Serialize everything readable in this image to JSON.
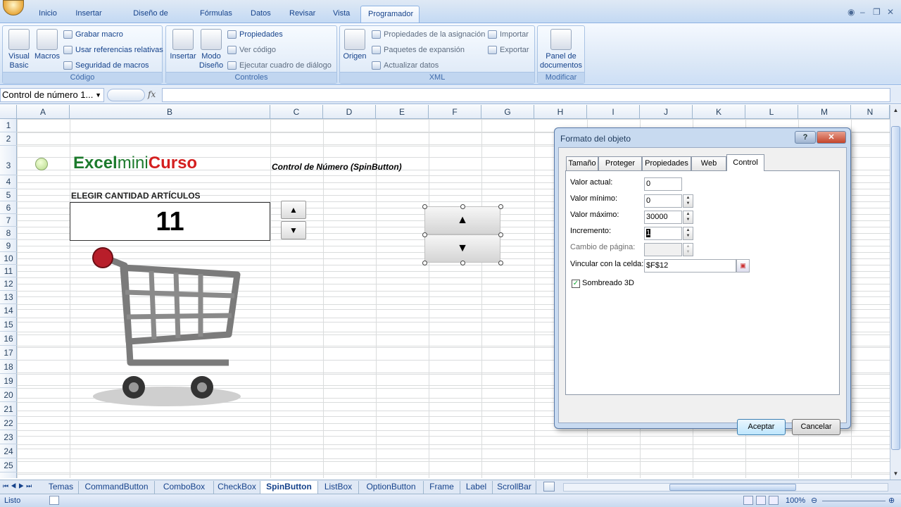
{
  "ribbon_tabs": [
    "Inicio",
    "Insertar",
    "Diseño de página",
    "Fórmulas",
    "Datos",
    "Revisar",
    "Vista",
    "Programador"
  ],
  "active_tab": "Programador",
  "groups": {
    "codigo": {
      "label": "Código",
      "visual_basic": "Visual Basic",
      "macros": "Macros",
      "grabar_macro": "Grabar macro",
      "usar_referencias": "Usar referencias relativas",
      "seguridad_macros": "Seguridad de macros"
    },
    "controles": {
      "label": "Controles",
      "insertar": "Insertar",
      "modo_diseno": "Modo Diseño",
      "propiedades": "Propiedades",
      "ver_codigo": "Ver código",
      "ejecutar_cuadro": "Ejecutar cuadro de diálogo"
    },
    "xml": {
      "label": "XML",
      "origen": "Origen",
      "propiedades_asignacion": "Propiedades de la asignación",
      "paquetes_expansion": "Paquetes de expansión",
      "actualizar_datos": "Actualizar datos",
      "importar": "Importar",
      "exportar": "Exportar"
    },
    "modificar": {
      "label": "Modificar",
      "panel_documentos": "Panel de documentos"
    }
  },
  "name_box": "Control de número 1...",
  "fx_symbol": "fx",
  "columns": [
    "A",
    "B",
    "C",
    "D",
    "E",
    "F",
    "G",
    "H",
    "I",
    "J",
    "K",
    "L",
    "M",
    "N"
  ],
  "rows": [
    "1",
    "2",
    "3",
    "4",
    "5",
    "6",
    "7",
    "8",
    "9",
    "10",
    "11",
    "12",
    "13",
    "14",
    "15",
    "16",
    "17",
    "18",
    "19",
    "20",
    "21",
    "22",
    "23",
    "24",
    "25"
  ],
  "sheet": {
    "logo_excel": "Excel",
    "logo_mini": "mini",
    "logo_curso": "Curso",
    "subtitle": "Control de Número (SpinButton)",
    "label_elegir": "ELEGIR CANTIDAD ARTÍCULOS",
    "cantidad": "11"
  },
  "dialog": {
    "title": "Formato del objeto",
    "help": "?",
    "close": "✕",
    "tabs": [
      "Tamaño",
      "Proteger",
      "Propiedades",
      "Web",
      "Control"
    ],
    "active_tab": "Control",
    "fields": {
      "valor_actual_label": "Valor actual:",
      "valor_actual": "0",
      "valor_minimo_label": "Valor mínimo:",
      "valor_minimo": "0",
      "valor_maximo_label": "Valor máximo:",
      "valor_maximo": "30000",
      "incremento_label": "Incremento:",
      "incremento": "1",
      "cambio_pagina_label": "Cambio de página:",
      "cambio_pagina": "",
      "vincular_label": "Vincular con la celda:",
      "vincular": "$F$12",
      "sombreado_label": "Sombreado 3D"
    },
    "sombreado_checked": true,
    "aceptar": "Aceptar",
    "cancelar": "Cancelar"
  },
  "sheet_tabs": [
    "Temas",
    "CommandButton",
    "ComboBox",
    "CheckBox",
    "SpinButton",
    "ListBox",
    "OptionButton",
    "Frame",
    "Label",
    "ScrollBar"
  ],
  "active_sheet": "SpinButton",
  "status": "Listo",
  "zoom": "100%"
}
